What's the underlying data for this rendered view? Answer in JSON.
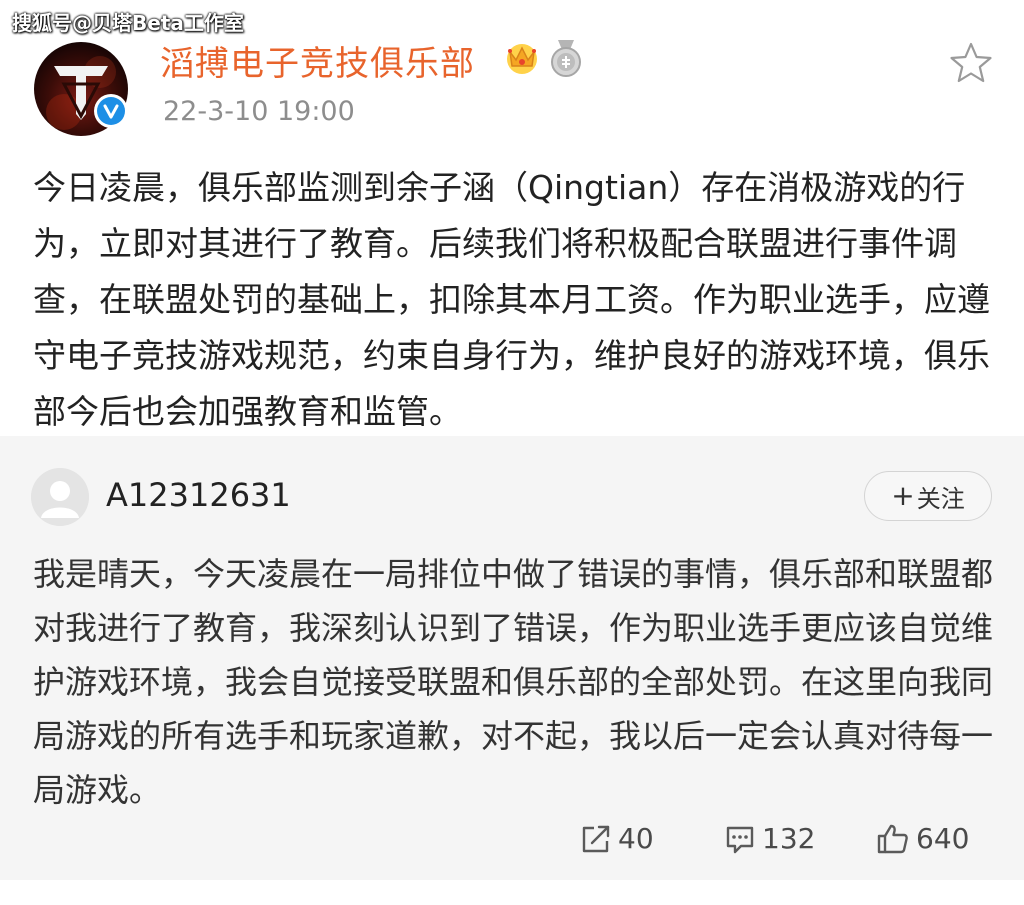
{
  "watermark": "搜狐号@贝塔Beta工作室",
  "post": {
    "author": "滔搏电子竞技俱乐部",
    "time": "22-3-10 19:00",
    "text": "今日凌晨，俱乐部监测到余子涵（Qingtian）存在消极游戏的行为，立即对其进行了教育。后续我们将积极配合联盟进行事件调查，在联盟处罚的基础上，扣除其本月工资。作为职业选手，应遵守电子竞技游戏规范，约束自身行为，维护良好的游戏环境，俱乐部今后也会加强教育和监管。",
    "icons": {
      "avatar": "club-logo-avatar",
      "verified": "verified-badge-icon",
      "crown": "crown-badge-icon",
      "medal": "medal-badge-icon",
      "favorite": "star-icon"
    },
    "colors": {
      "author": "#e8642c",
      "verified": "#1d8fe6"
    }
  },
  "retweet": {
    "user": "A12312631",
    "follow_label": "关注",
    "follow_plus": "+",
    "text": "我是晴天，今天凌晨在一局排位中做了错误的事情，俱乐部和联盟都对我进行了教育，我深刻认识到了错误，作为职业选手更应该自觉维护游戏环境，我会自觉接受联盟和俱乐部的全部处罚。在这里向我同局游戏的所有选手和玩家道歉，对不起，我以后一定会认真对待每一局游戏。",
    "stats": {
      "reposts": "40",
      "comments": "132",
      "likes": "640"
    },
    "icons": {
      "avatar": "default-avatar-icon",
      "repost": "repost-icon",
      "comment": "comment-icon",
      "like": "thumbs-up-icon"
    }
  }
}
